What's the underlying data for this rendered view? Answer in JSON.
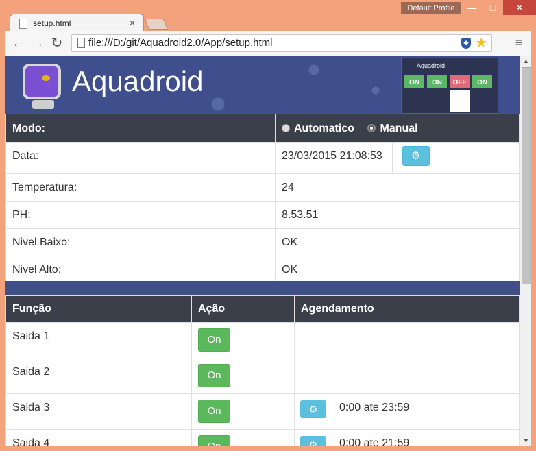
{
  "browser": {
    "profile_label": "Default Profile",
    "tab_title": "setup.html",
    "address": "file:///D:/git/Aquadroid2.0/App/setup.html"
  },
  "header": {
    "brand": "Aquadroid",
    "preview": {
      "title": "Aquadroid",
      "tiles": [
        "ON",
        "ON",
        "OFF",
        "ON"
      ]
    }
  },
  "mode": {
    "label": "Modo:",
    "options": [
      "Automatico",
      "Manual"
    ],
    "selected": "Manual"
  },
  "status": {
    "date_label": "Data:",
    "date_value": "23/03/2015 21:08:53",
    "temperature_label": "Temperatura:",
    "temperature_value": "24",
    "ph_label": "PH:",
    "ph_value": "8.53.51",
    "low_level_label": "Nivel Baixo:",
    "low_level_value": "OK",
    "high_level_label": "Nivel Alto:",
    "high_level_value": "OK"
  },
  "functions": {
    "headers": [
      "Função",
      "Ação",
      "Agendamento"
    ],
    "rows": [
      {
        "name": "Saida 1",
        "action": "On",
        "schedule": ""
      },
      {
        "name": "Saida 2",
        "action": "On",
        "schedule": ""
      },
      {
        "name": "Saida 3",
        "action": "On",
        "schedule": "0:00 ate 23:59"
      },
      {
        "name": "Saida 4",
        "action": "On",
        "schedule": "0:00 ate 21:59"
      }
    ]
  },
  "icons": {
    "gear": "gear-icon",
    "radio": "radio-icon"
  }
}
